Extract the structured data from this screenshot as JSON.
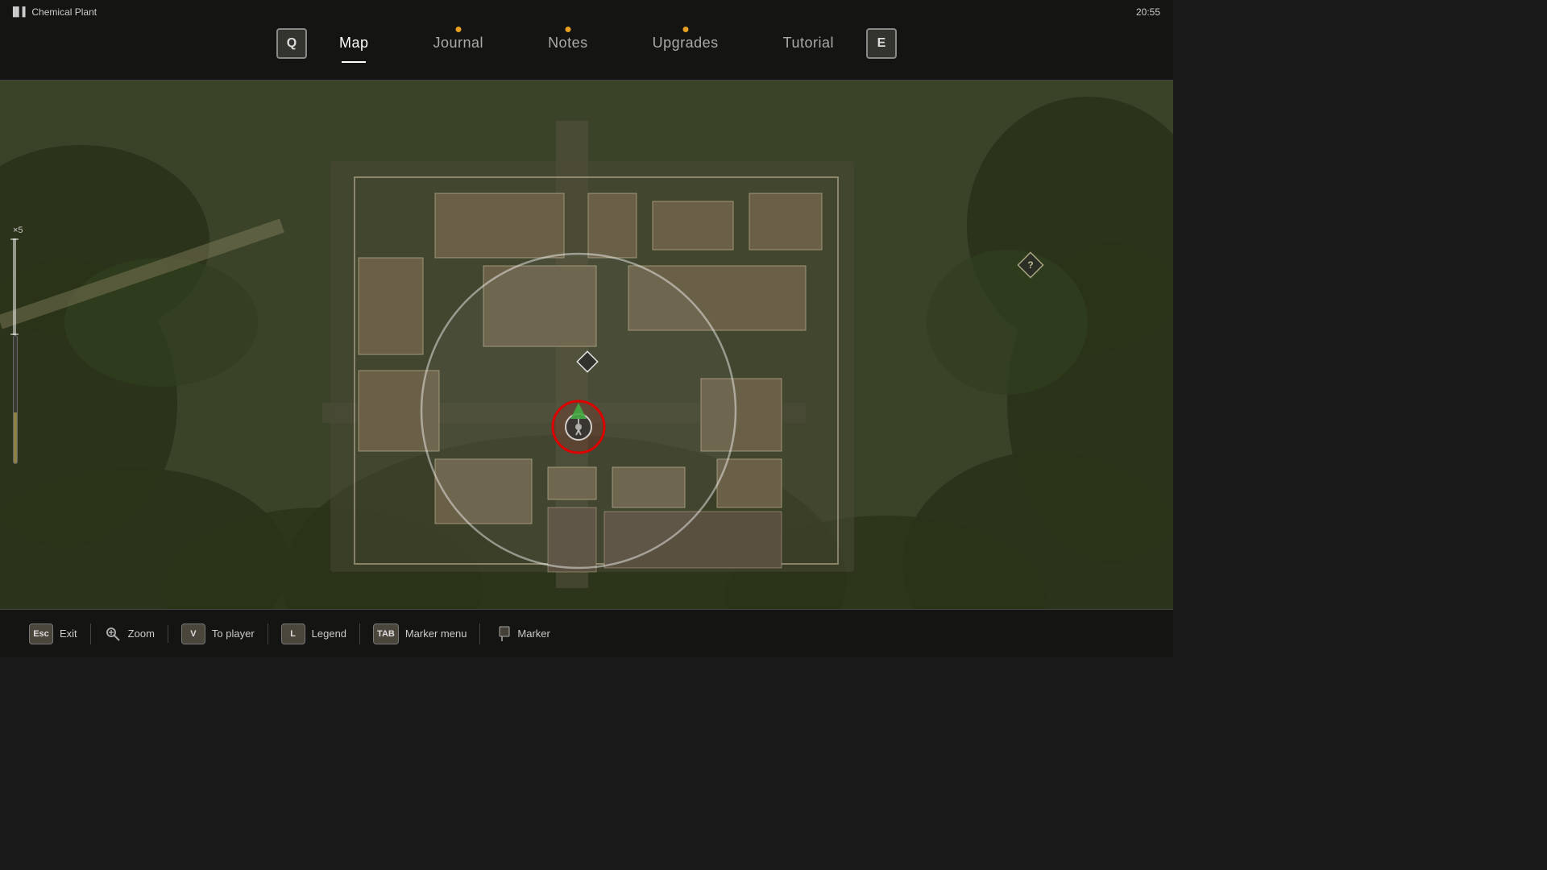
{
  "topbar": {
    "location": "Chemical Plant",
    "signal_icon": "▐▌▌",
    "time": "20:55",
    "prev_key": "Q",
    "next_key": "E"
  },
  "nav": {
    "tabs": [
      {
        "id": "map",
        "label": "Map",
        "active": true,
        "has_dot": false
      },
      {
        "id": "journal",
        "label": "Journal",
        "active": false,
        "has_dot": true
      },
      {
        "id": "notes",
        "label": "Notes",
        "active": false,
        "has_dot": true
      },
      {
        "id": "upgrades",
        "label": "Upgrades",
        "active": false,
        "has_dot": true
      },
      {
        "id": "tutorial",
        "label": "Tutorial",
        "active": false,
        "has_dot": false
      }
    ]
  },
  "scale": {
    "label": "×5"
  },
  "bottombar": {
    "actions": [
      {
        "key": "Esc",
        "icon": "",
        "label": "Exit"
      },
      {
        "key": "",
        "icon": "🔍",
        "label": "Zoom"
      },
      {
        "key": "V",
        "icon": "",
        "label": "To player"
      },
      {
        "key": "L",
        "icon": "",
        "label": "Legend"
      },
      {
        "key": "TAB",
        "icon": "",
        "label": "Marker menu"
      },
      {
        "key": "",
        "icon": "📌",
        "label": "Marker"
      }
    ]
  }
}
